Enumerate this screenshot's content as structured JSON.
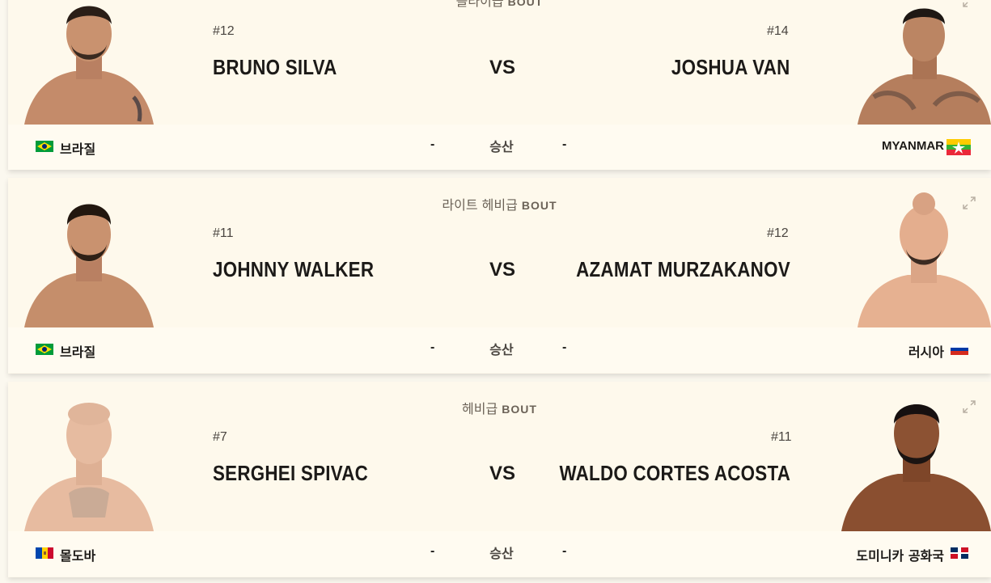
{
  "bouts": [
    {
      "weight_class": "플라이급",
      "bout_word": "BOUT",
      "red": {
        "rank": "#12",
        "name": "BRUNO SILVA",
        "country": "브라질",
        "flag": "brazil"
      },
      "blue": {
        "rank": "#14",
        "name": "JOSHUA VAN",
        "country": "MYANMAR",
        "flag": "myanmar"
      },
      "vs": "VS",
      "red_odds": "-",
      "blue_odds": "-",
      "result_label": "승산"
    },
    {
      "weight_class": "라이트 헤비급",
      "bout_word": "BOUT",
      "red": {
        "rank": "#11",
        "name": "JOHNNY WALKER",
        "country": "브라질",
        "flag": "brazil"
      },
      "blue": {
        "rank": "#12",
        "name": "AZAMAT MURZAKANOV",
        "country": "러시아",
        "flag": "russia"
      },
      "vs": "VS",
      "red_odds": "-",
      "blue_odds": "-",
      "result_label": "승산"
    },
    {
      "weight_class": "헤비급",
      "bout_word": "BOUT",
      "red": {
        "rank": "#7",
        "name": "SERGHEI SPIVAC",
        "country": "몰도바",
        "flag": "moldova"
      },
      "blue": {
        "rank": "#11",
        "name": "WALDO CORTES ACOSTA",
        "country": "도미니카 공화국",
        "flag": "dominican-republic"
      },
      "vs": "VS",
      "red_odds": "-",
      "blue_odds": "-",
      "result_label": "승산"
    }
  ],
  "colors": {
    "background": "#fbf8ef",
    "card": "#fef9ec",
    "text": "#1c1a18",
    "muted": "#6b6257",
    "skin": "#c98f6c"
  }
}
